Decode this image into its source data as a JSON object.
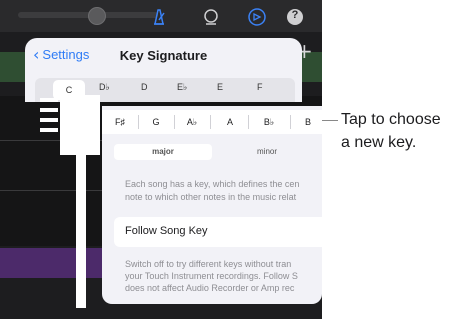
{
  "toolbar": {
    "icons": [
      "metronome-icon",
      "loop-browser-icon",
      "settings-gear-icon",
      "help-icon"
    ],
    "help_label": "?",
    "add_label": "+"
  },
  "settings_popover": {
    "back_label": "Settings",
    "title": "Key Signature",
    "row1_keys": [
      "C",
      "D♭",
      "D",
      "E♭",
      "E",
      "F"
    ]
  },
  "zoom_panel": {
    "keys": [
      "F♯",
      "G",
      "A♭",
      "A",
      "B♭",
      "B"
    ],
    "mode_major": "major",
    "mode_minor": "minor",
    "description_lines": [
      "Each song has a key, which defines the cen",
      "note to which other notes in the music relat"
    ],
    "follow_label": "Follow Song Key",
    "follow_description_lines": [
      "Switch off to try different keys without tran",
      "your Touch Instrument recordings. Follow S",
      "does not affect Audio Recorder or Amp rec"
    ]
  },
  "callout": {
    "line1": "Tap to choose",
    "line2": "a new key."
  },
  "colors": {
    "accent": "#2f7cf6",
    "panel": "#f2f2f7",
    "app_bg": "#1d1d1f"
  }
}
